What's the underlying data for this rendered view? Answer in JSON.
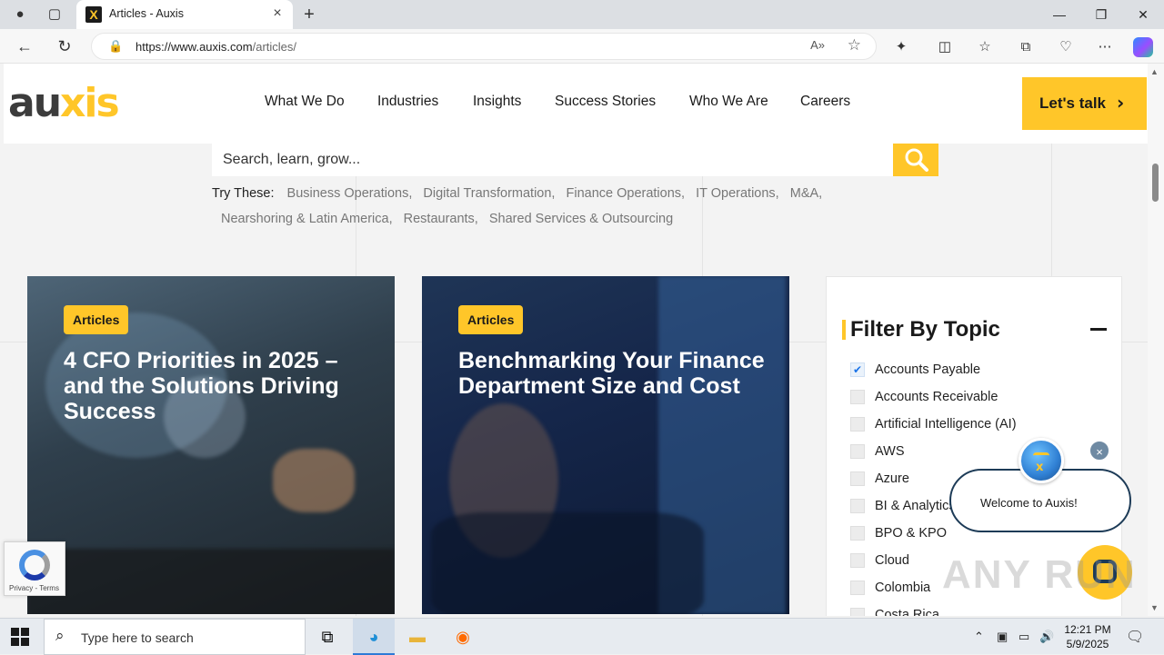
{
  "browser": {
    "tab_title": "Articles - Auxis",
    "url_host": "https://www.auxis.com",
    "url_path": "/articles/",
    "new_tab": "+",
    "tab_close": "×",
    "minimize": "—",
    "restore": "❐",
    "close": "✕"
  },
  "header": {
    "logo_parts": [
      "au",
      "x",
      "is"
    ],
    "nav": [
      "What We Do",
      "Industries",
      "Insights",
      "Success Stories",
      "Who We Are",
      "Careers"
    ],
    "cta_label": "Let's talk",
    "cta_chevron": "›"
  },
  "search": {
    "placeholder": "Search, learn, grow...",
    "try_label": "Try These:",
    "row1": [
      "Business Operations,",
      "Digital Transformation,",
      "Finance Operations,",
      "IT Operations,",
      "M&A,"
    ],
    "row2": [
      "Nearshoring & Latin America,",
      "Restaurants,",
      "Shared Services & Outsourcing"
    ]
  },
  "cards": [
    {
      "badge": "Articles",
      "title": "4 CFO Priorities in 2025 – and the Solutions Driving Success"
    },
    {
      "badge": "Articles",
      "title": "Benchmarking Your Finance Department Size and Cost"
    }
  ],
  "filter": {
    "title": "Filter By Topic",
    "topics": [
      {
        "label": "Accounts Payable",
        "checked": true
      },
      {
        "label": "Accounts Receivable",
        "checked": false
      },
      {
        "label": "Artificial Intelligence (AI)",
        "checked": false
      },
      {
        "label": "AWS",
        "checked": false
      },
      {
        "label": "Azure",
        "checked": false
      },
      {
        "label": "BI & Analytics",
        "checked": false
      },
      {
        "label": "BPO & KPO",
        "checked": false
      },
      {
        "label": "Cloud",
        "checked": false
      },
      {
        "label": "Colombia",
        "checked": false
      },
      {
        "label": "Costa Rica",
        "checked": false
      }
    ]
  },
  "chat": {
    "welcome": "Welcome to Auxis!",
    "close": "×"
  },
  "recaptcha": {
    "text": "Privacy - Terms"
  },
  "watermark": "ANY RUN",
  "taskbar": {
    "search_placeholder": "Type here to search",
    "time": "12:21 PM",
    "date": "5/9/2025"
  }
}
